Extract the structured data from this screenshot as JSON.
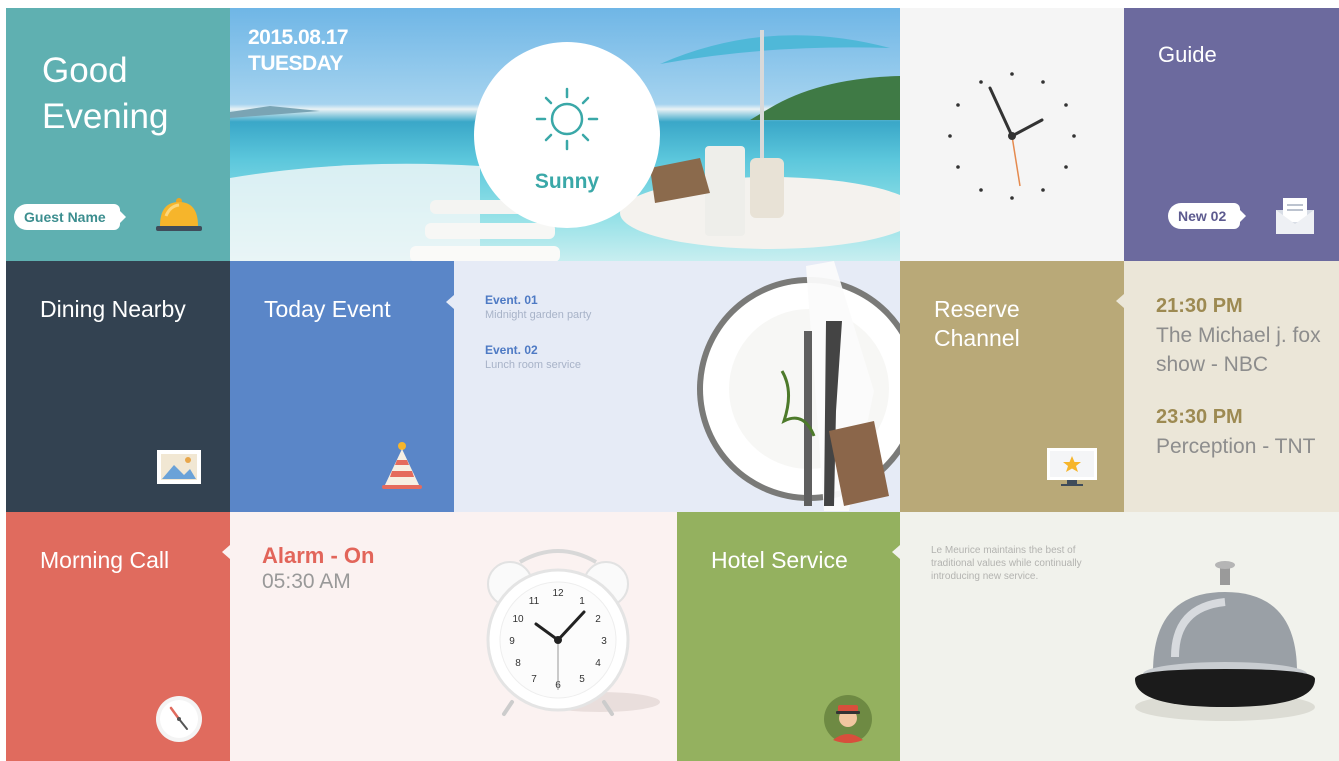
{
  "greeting": {
    "title": "Good Evening",
    "guest_label": "Guest Name"
  },
  "weather": {
    "date": "2015.08.17",
    "day": "TUESDAY",
    "condition": "Sunny"
  },
  "guide": {
    "title": "Guide",
    "badge": "New 02"
  },
  "dining": {
    "title": "Dining Nearby"
  },
  "today_event": {
    "title": "Today Event",
    "events": [
      {
        "name": "Event. 01",
        "desc": "Midnight garden party"
      },
      {
        "name": "Event. 02",
        "desc": "Lunch room service"
      }
    ]
  },
  "reserve": {
    "title": "Reserve Channel",
    "programs": [
      {
        "time": "21:30 PM",
        "show": "The Michael j. fox show - NBC"
      },
      {
        "time": "23:30 PM",
        "show": "Perception - TNT"
      }
    ]
  },
  "morning_call": {
    "title": "Morning Call",
    "status": "Alarm - On",
    "time": "05:30 AM"
  },
  "hotel_service": {
    "title": "Hotel Service",
    "desc": "Le Meurice maintains the best of traditional values while continually introducing new service."
  },
  "colors": {
    "teal": "#5fb0b1",
    "purple": "#6c6a9e",
    "navy": "#334251",
    "blue": "#5a86c8",
    "khaki": "#b9a978",
    "coral": "#e06b5e",
    "green": "#94b15f"
  },
  "icons": [
    "bell-icon",
    "sun-icon",
    "envelope-icon",
    "picture-icon",
    "party-hat-icon",
    "tv-star-icon",
    "clock-icon",
    "bellboy-icon"
  ]
}
